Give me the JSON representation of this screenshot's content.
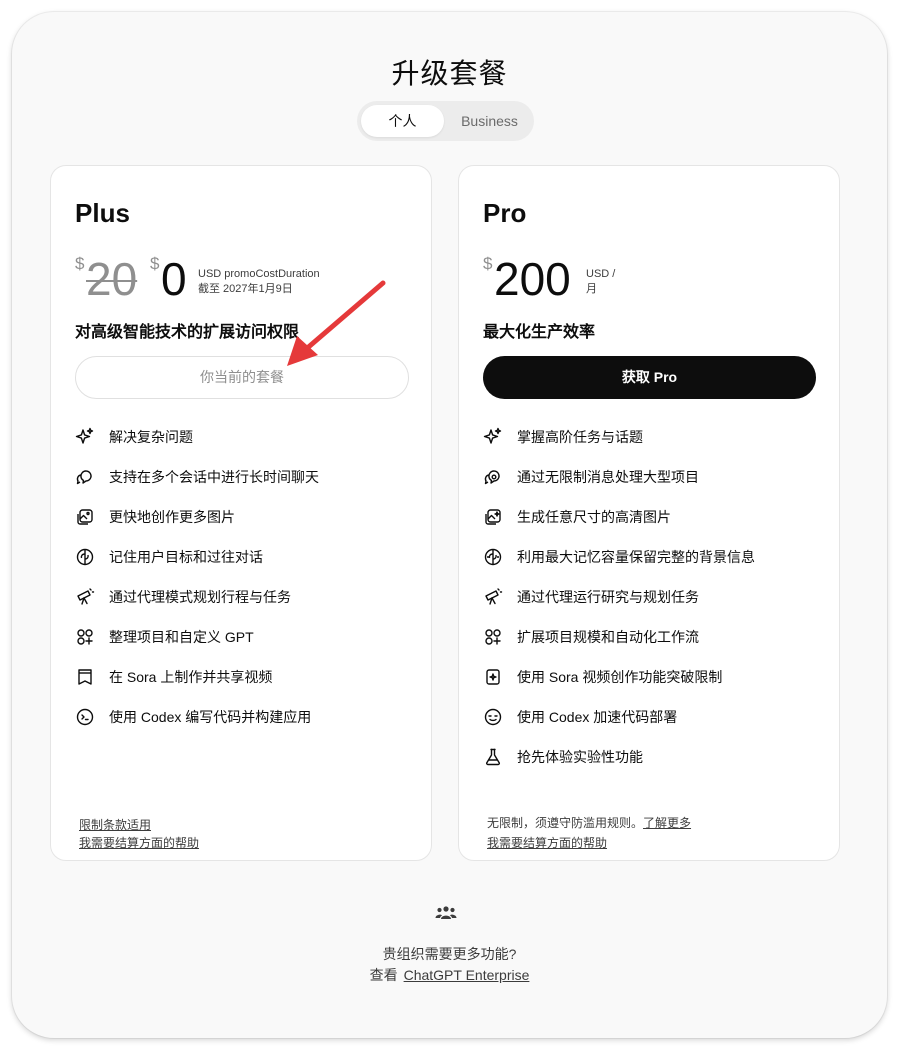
{
  "page": {
    "title": "升级套餐"
  },
  "toggle": {
    "personal": "个人",
    "business": "Business"
  },
  "plus": {
    "name": "Plus",
    "currency_symbol": "$",
    "old_price": "20",
    "price": "0",
    "price_note_line1": "USD promoCostDuration",
    "price_note_line2": "截至 2027年1月9日",
    "tagline": "对高级智能技术的扩展访问权限",
    "button_label": "你当前的套餐",
    "features": [
      {
        "icon": "sparkles-icon",
        "text": "解决复杂问题"
      },
      {
        "icon": "chat-bubbles-icon",
        "text": "支持在多个会话中进行长时间聊天"
      },
      {
        "icon": "image-icon",
        "text": "更快地创作更多图片"
      },
      {
        "icon": "brain-icon",
        "text": "记住用户目标和过往对话"
      },
      {
        "icon": "telescope-icon",
        "text": "通过代理模式规划行程与任务"
      },
      {
        "icon": "apps-icon",
        "text": "整理项目和自定义 GPT"
      },
      {
        "icon": "film-icon",
        "text": "在 Sora 上制作并共享视频"
      },
      {
        "icon": "terminal-icon",
        "text": "使用 Codex 编写代码并构建应用"
      }
    ],
    "footer_link1": "限制条款适用",
    "footer_link2": "我需要结算方面的帮助"
  },
  "pro": {
    "name": "Pro",
    "currency_symbol": "$",
    "price": "200",
    "price_note_line1": "USD /",
    "price_note_line2": "月",
    "tagline": "最大化生产效率",
    "button_label": "获取 Pro",
    "features": [
      {
        "icon": "sparkles-icon",
        "text": "掌握高阶任务与话题"
      },
      {
        "icon": "chat-bubbles-icon",
        "text": "通过无限制消息处理大型项目"
      },
      {
        "icon": "image-icon",
        "text": "生成任意尺寸的高清图片"
      },
      {
        "icon": "brain-icon",
        "text": "利用最大记忆容量保留完整的背景信息"
      },
      {
        "icon": "telescope-icon",
        "text": "通过代理运行研究与规划任务"
      },
      {
        "icon": "apps-icon",
        "text": "扩展项目规模和自动化工作流"
      },
      {
        "icon": "film-icon",
        "text": "使用 Sora 视频创作功能突破限制"
      },
      {
        "icon": "terminal-icon",
        "text": "使用 Codex 加速代码部署"
      },
      {
        "icon": "flask-icon",
        "text": "抢先体验实验性功能"
      }
    ],
    "footer_text": "无限制，须遵守防滥用规则。",
    "footer_learn_more": "了解更多",
    "footer_link2": "我需要结算方面的帮助"
  },
  "enterprise": {
    "icon": "group-icon",
    "question": "贵组织需要更多功能?",
    "prefix": "查看",
    "link": "ChatGPT Enterprise"
  },
  "colors": {
    "annotation_arrow": "#e5393a",
    "primary_button": "#0d0d0d",
    "modal_background": "#f9f9f9"
  }
}
